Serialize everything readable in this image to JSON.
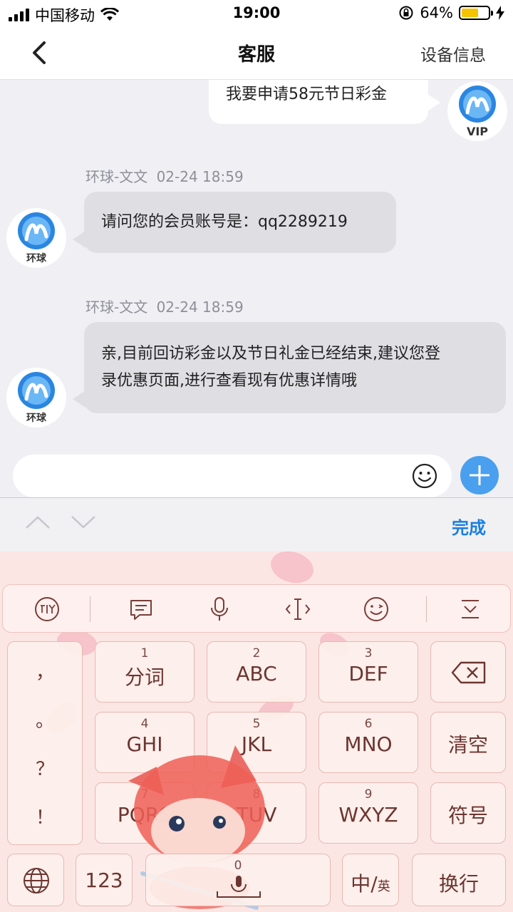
{
  "status_bar": {
    "carrier": "中国移动",
    "time": "19:00",
    "battery_percent": "64%",
    "battery_level": 0.64
  },
  "nav": {
    "title": "客服",
    "right_action": "设备信息"
  },
  "chat": {
    "messages": [
      {
        "side": "right",
        "text": "我要申请58元节日彩金",
        "avatar_label": "VIP"
      },
      {
        "side": "left",
        "sender": "环球-文文",
        "time": "02-24 18:59",
        "text": "请问您的会员账号是：qq2289219",
        "avatar_label": "环球"
      },
      {
        "side": "left",
        "sender": "环球-文文",
        "time": "02-24 18:59",
        "text_line1": "亲,目前回访彩金以及节日礼金已经结束,建议您登",
        "text_line2": "录优惠页面,进行查看现有优惠详情哦",
        "avatar_label": "环球"
      }
    ]
  },
  "input": {
    "placeholder": "",
    "emoji_icon": "smiley-icon",
    "plus_icon": "plus-icon"
  },
  "kb_toolbar": {
    "done_label": "完成"
  },
  "keyboard": {
    "top_icons": [
      "ime-logo-icon",
      "clipboard-icon",
      "microphone-icon",
      "text-cursor-icon",
      "emoji-icon",
      "collapse-keyboard-icon"
    ],
    "punct": [
      "，",
      "。",
      "？",
      "！"
    ],
    "keys": [
      {
        "num": "1",
        "label": "分词"
      },
      {
        "num": "2",
        "label": "ABC"
      },
      {
        "num": "3",
        "label": "DEF"
      },
      {
        "num": "4",
        "label": "GHI"
      },
      {
        "num": "5",
        "label": "JKL"
      },
      {
        "num": "6",
        "label": "MNO"
      },
      {
        "num": "7",
        "label": "PQRS"
      },
      {
        "num": "8",
        "label": "TUV"
      },
      {
        "num": "9",
        "label": "WXYZ"
      }
    ],
    "clear": "清空",
    "symbols": "符号",
    "num_key": "123",
    "space_num": "0",
    "lang_main": "中/",
    "lang_sub": "英",
    "newline": "换行"
  },
  "colors": {
    "accent": "#4a9fee",
    "done": "#1a7fe0",
    "keyboard_bg": "#fbe6e4"
  }
}
